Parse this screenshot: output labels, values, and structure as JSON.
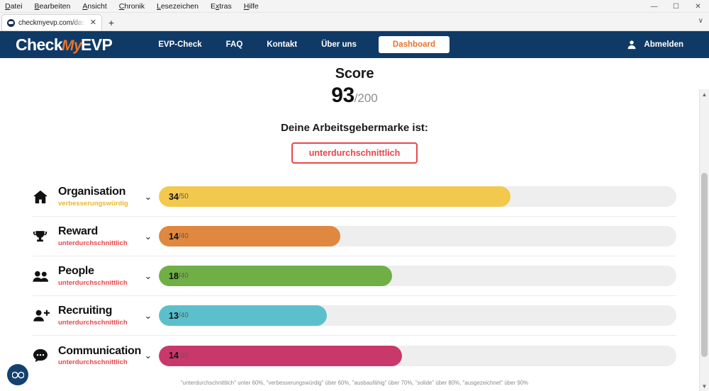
{
  "browser": {
    "menus": [
      {
        "label": "Datei",
        "accel": "D"
      },
      {
        "label": "Bearbeiten",
        "accel": "B"
      },
      {
        "label": "Ansicht",
        "accel": "A"
      },
      {
        "label": "Chronik",
        "accel": "C"
      },
      {
        "label": "Lesezeichen",
        "accel": "L"
      },
      {
        "label": "Extras",
        "accel": "x"
      },
      {
        "label": "Hilfe",
        "accel": "H"
      }
    ],
    "window_controls": {
      "minimize": "—",
      "maximize": "☐",
      "close": "✕",
      "overflow": "∨"
    },
    "tab": {
      "title": "checkmyevp.com/dashboard",
      "close": "✕"
    },
    "new_tab": "+",
    "toolbar_chevron": "∨"
  },
  "navbar": {
    "logo": {
      "part1": "Check",
      "part2": "My",
      "part3": "EVP"
    },
    "links": [
      {
        "label": "EVP-Check"
      },
      {
        "label": "FAQ"
      },
      {
        "label": "Kontakt"
      },
      {
        "label": "Über uns"
      }
    ],
    "dashboard_button": "Dashboard",
    "logout_label": "Abmelden",
    "bg_color": "#103a66",
    "accent_color": "#e8742c"
  },
  "score": {
    "title": "Score",
    "value": "93",
    "max": "/200"
  },
  "brand": {
    "question": "Deine Arbeitsgebermarke ist:",
    "badge_label": "unterdurchschnittlich",
    "badge_color": "#e8474c"
  },
  "categories": [
    {
      "icon": "home-icon",
      "name": "Organisation",
      "rating": "verbesserungswürdig",
      "rating_color": "#e8b830",
      "value": "34",
      "max": "/50",
      "score": 34,
      "out_of": 50,
      "fill_percent": 68,
      "bar_color": "#f2c94c",
      "chevron": "⌄"
    },
    {
      "icon": "trophy-icon",
      "name": "Reward",
      "rating": "unterdurchschnittlich",
      "rating_color": "#e8474c",
      "value": "14",
      "max": "/40",
      "score": 14,
      "out_of": 40,
      "fill_percent": 35,
      "bar_color": "#e08740",
      "chevron": "⌄"
    },
    {
      "icon": "people-icon",
      "name": "People",
      "rating": "unterdurchschnittlich",
      "rating_color": "#e8474c",
      "value": "18",
      "max": "/40",
      "score": 18,
      "out_of": 40,
      "fill_percent": 45,
      "bar_color": "#6faf46",
      "chevron": "⌄"
    },
    {
      "icon": "person-add-icon",
      "name": "Recruiting",
      "rating": "unterdurchschnittlich",
      "rating_color": "#e8474c",
      "value": "13",
      "max": "/40",
      "score": 13,
      "out_of": 40,
      "fill_percent": 32.5,
      "bar_color": "#5bc0cc",
      "chevron": "⌄"
    },
    {
      "icon": "chat-bubble-icon",
      "name": "Communication",
      "rating": "unterdurchschnittlich",
      "rating_color": "#e8474c",
      "value": "14",
      "max": "/30",
      "score": 14,
      "out_of": 30,
      "fill_percent": 47,
      "bar_color": "#c9386b",
      "chevron": "⌄"
    }
  ],
  "footnote": "\"unterdurchschnittlich\" unter 60%, \"verbesserungswürdig\" über 60%, \"ausbaufähig\" über 70%, \"solide\" über 80%, \"ausgezeichnet\" über 90%",
  "widget": {
    "label": "∞"
  },
  "chart_data": {
    "type": "bar",
    "title": "Score 93/200",
    "categories": [
      "Organisation",
      "Reward",
      "People",
      "Recruiting",
      "Communication"
    ],
    "values": [
      34,
      14,
      18,
      13,
      14
    ],
    "maxima": [
      50,
      40,
      40,
      40,
      30
    ],
    "percent": [
      68,
      35,
      45,
      32.5,
      47
    ],
    "colors": [
      "#f2c94c",
      "#e08740",
      "#6faf46",
      "#5bc0cc",
      "#c9386b"
    ],
    "ratings": [
      "verbesserungswürdig",
      "unterdurchschnittlich",
      "unterdurchschnittlich",
      "unterdurchschnittlich",
      "unterdurchschnittlich"
    ],
    "xlabel": "",
    "ylabel": "",
    "ylim": [
      0,
      100
    ],
    "grid": false,
    "legend": "none",
    "annotation": "\"unterdurchschnittlich\" unter 60%, \"verbesserungswürdig\" über 60%, \"ausbaufähig\" über 70%, \"solide\" über 80%, \"ausgezeichnet\" über 90%"
  }
}
